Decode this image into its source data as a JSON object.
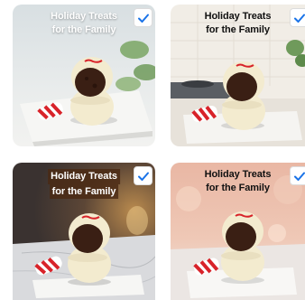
{
  "tiles": [
    {
      "caption_line1": "Holiday Treats",
      "caption_line2": "for the Family",
      "selected": true,
      "background": "light-kitchen-with-plant"
    },
    {
      "caption_line1": "Holiday Treats",
      "caption_line2": "for the Family",
      "selected": true,
      "background": "kitchen-counter-with-stove"
    },
    {
      "caption_line1": "Holiday Treats",
      "caption_line2": "for the Family",
      "selected": true,
      "background": "dark-marble-with-candle"
    },
    {
      "caption_line1": "Holiday Treats",
      "caption_line2": "for the Family",
      "selected": true,
      "background": "warm-bokeh-lights"
    }
  ],
  "icons": {
    "checkbox": "checkmark-icon"
  },
  "colors": {
    "check_accent": "#1a73e8",
    "truffle_coating": "#f4ecd0",
    "cookie_filling": "#3a1f14",
    "candy_stripe": "#d8232a"
  }
}
